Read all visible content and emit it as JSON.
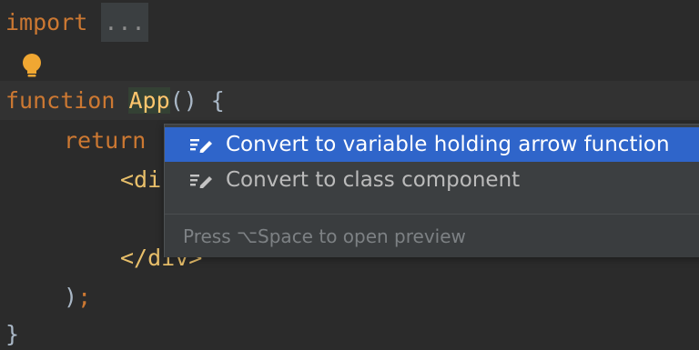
{
  "code": {
    "import_kw": "import",
    "import_fold": "...",
    "function_kw": "function",
    "function_name": "App",
    "function_sig": "() {",
    "return_kw": "return",
    "div_open_partial": "<di",
    "div_close_partial": "</div>",
    "close_paren": ")",
    "semicolon": ";",
    "close_brace": "}"
  },
  "icons": {
    "bulb": "lightbulb-icon",
    "intention": "pencil-edit-icon"
  },
  "colors": {
    "background": "#2b2b2b",
    "keyword": "#cc7832",
    "function_name": "#ffc66d",
    "tag": "#e8bf6a",
    "bulb": "#f0a732",
    "selection": "#2f65ca"
  },
  "popup": {
    "items": [
      {
        "label": "Convert to variable holding arrow function"
      },
      {
        "label": "Convert to class component"
      }
    ],
    "hint": "Press ⌥Space to open preview"
  }
}
